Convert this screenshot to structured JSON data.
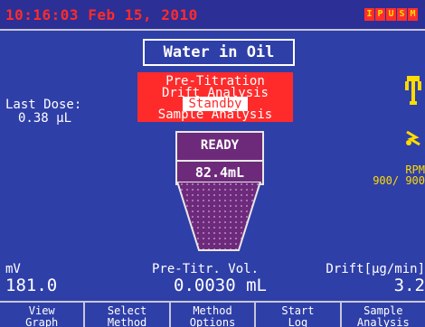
{
  "header": {
    "datetime": "10:16:03 Feb 15, 2010",
    "status_badges": [
      "I",
      "P",
      "U",
      "S",
      "M"
    ]
  },
  "method": {
    "title": "Water in Oil"
  },
  "last_dose": {
    "label": "Last Dose:",
    "value": "0.38 μL"
  },
  "states": {
    "items": [
      "Pre-Titration",
      "Drift Analysis",
      "Standby",
      "Sample Analysis"
    ],
    "active": "Standby"
  },
  "vessel": {
    "status": "READY",
    "volume": "82.4mL"
  },
  "stirrer": {
    "label": "RPM",
    "values": "900/ 900"
  },
  "icons": {
    "probe": "electrode-probe-icon",
    "stirrer": "stirrer-icon"
  },
  "readouts": {
    "mv": {
      "label": "mV",
      "value": "181.0"
    },
    "pretitr": {
      "label": "Pre-Titr. Vol.",
      "value": "0.0030 mL"
    },
    "drift": {
      "label": "Drift[μg/min]",
      "value": "3.2"
    }
  },
  "softkeys": [
    {
      "line1": "View",
      "line2": "Graph"
    },
    {
      "line1": "Select",
      "line2": "Method"
    },
    {
      "line1": "Method",
      "line2": "Options"
    },
    {
      "line1": "Start",
      "line2": "Log"
    },
    {
      "line1": "Sample",
      "line2": "Analysis"
    }
  ],
  "colors": {
    "background": "#2f3fa8",
    "accent_red": "#ff2b2b",
    "accent_yellow": "#ffdb00",
    "vessel_purple": "#6e2a7a"
  }
}
